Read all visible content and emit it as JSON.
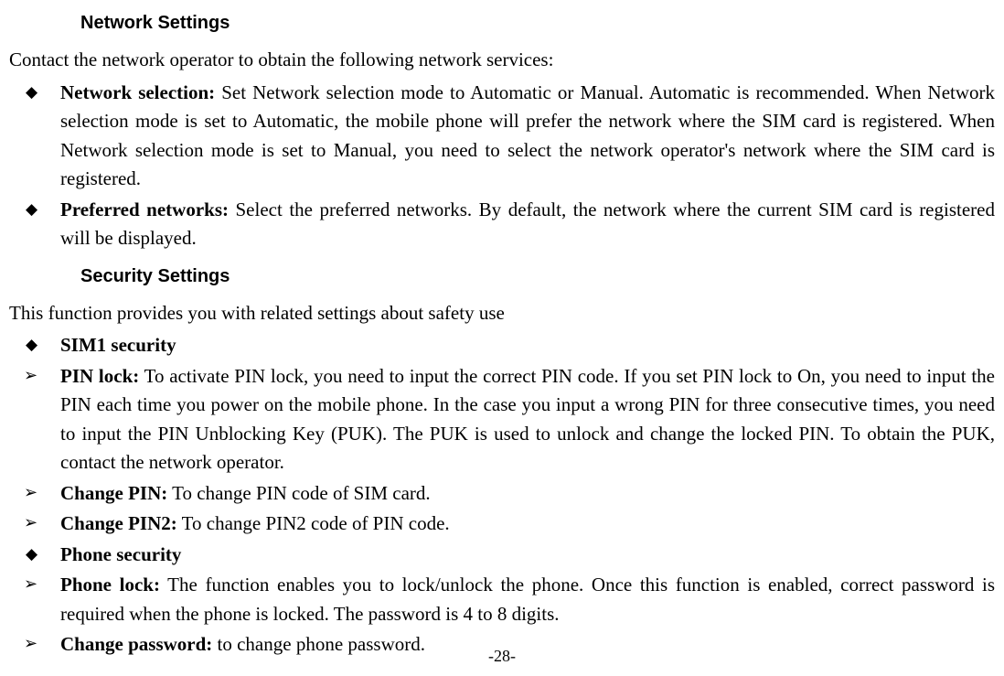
{
  "section1": {
    "heading": "Network Settings",
    "intro": "Contact the network operator to obtain the following network services:",
    "items": [
      {
        "term": "Network selection:",
        "text": " Set Network selection mode to Automatic or Manual. Automatic is recommended. When Network selection mode is set to Automatic, the mobile phone will prefer the network where the SIM card is registered. When Network selection mode is set to Manual, you need to select the network operator's network where the SIM card is registered."
      },
      {
        "term": "Preferred networks:",
        "text": " Select the preferred networks. By default, the network where the current SIM card is registered will be displayed."
      }
    ]
  },
  "section2": {
    "heading": "Security Settings",
    "intro": "This function provides you with related settings about safety use",
    "items": [
      {
        "bullet": "diamond",
        "term": "SIM1 security",
        "text": ""
      },
      {
        "bullet": "arrow",
        "term": "PIN lock:",
        "text": " To activate PIN lock, you need to input the correct PIN code. If you set PIN lock to On, you need to input the PIN each time you power on the mobile phone. In the case you input a wrong PIN for three consecutive times, you need to input the PIN Unblocking Key (PUK). The PUK is used to unlock and change the locked PIN. To obtain the PUK, contact the network operator."
      },
      {
        "bullet": "arrow",
        "term": "Change PIN:",
        "text": " To change PIN code of SIM card."
      },
      {
        "bullet": "arrow",
        "term": "Change PIN2:",
        "text": " To change PIN2 code of PIN code."
      },
      {
        "bullet": "diamond",
        "term": "Phone security",
        "text": ""
      },
      {
        "bullet": "arrow",
        "term": "Phone lock:",
        "text": " The function enables you to lock/unlock the phone. Once this function is enabled, correct password is required when the phone is locked. The password is 4 to 8 digits."
      },
      {
        "bullet": "arrow",
        "term": "Change password:",
        "text": " to change phone password."
      }
    ]
  },
  "pageNumber": "-28-"
}
